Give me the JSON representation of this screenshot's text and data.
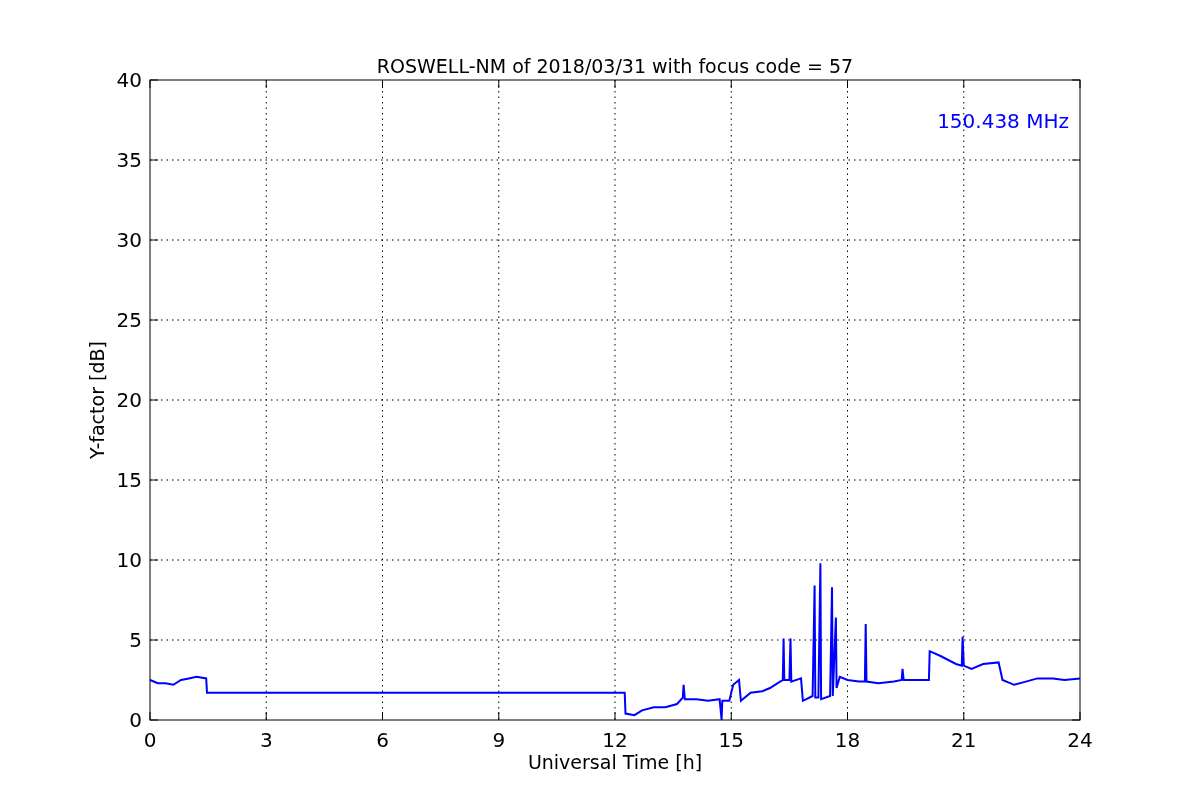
{
  "figure": {
    "chart_data": {
      "type": "line",
      "title": "ROSWELL-NM of 2018/03/31 with focus code = 57",
      "xlabel": "Universal Time [h]",
      "ylabel": "Y-factor [dB]",
      "xlim": [
        0,
        24
      ],
      "ylim": [
        0,
        40
      ],
      "xticks": [
        0,
        3,
        6,
        9,
        12,
        15,
        18,
        21,
        24
      ],
      "yticks": [
        0,
        5,
        10,
        15,
        20,
        25,
        30,
        35,
        40
      ],
      "x": [
        0,
        0.2,
        0.4,
        0.6,
        0.8,
        1.0,
        1.2,
        1.45,
        1.47,
        12.25,
        12.27,
        12.5,
        12.7,
        13.0,
        13.3,
        13.6,
        13.75,
        13.77,
        13.8,
        14.1,
        14.4,
        14.7,
        14.75,
        14.77,
        14.95,
        15.05,
        15.2,
        15.25,
        15.5,
        15.8,
        16.0,
        16.2,
        16.33,
        16.35,
        16.37,
        16.5,
        16.53,
        16.55,
        16.8,
        16.85,
        17.1,
        17.15,
        17.17,
        17.25,
        17.3,
        17.32,
        17.55,
        17.6,
        17.62,
        17.7,
        17.72,
        17.8,
        18.0,
        18.3,
        18.45,
        18.47,
        18.49,
        18.8,
        19.2,
        19.4,
        19.42,
        19.45,
        19.8,
        20.1,
        20.12,
        20.4,
        20.8,
        20.95,
        20.97,
        21.0,
        21.2,
        21.5,
        21.9,
        22.0,
        22.3,
        22.6,
        22.9,
        23.3,
        23.6,
        24
      ],
      "series": [
        {
          "name": "150.438 MHz",
          "color": "#0000ff",
          "values": [
            2.5,
            2.3,
            2.3,
            2.2,
            2.5,
            2.6,
            2.7,
            2.6,
            1.7,
            1.7,
            0.4,
            0.3,
            0.6,
            0.8,
            0.8,
            1.0,
            1.4,
            2.2,
            1.3,
            1.3,
            1.2,
            1.3,
            0,
            1.2,
            1.2,
            2.2,
            2.5,
            1.2,
            1.7,
            1.8,
            2.0,
            2.3,
            2.5,
            5.1,
            2.5,
            2.5,
            5.1,
            2.4,
            2.6,
            1.2,
            1.5,
            8.4,
            1.4,
            1.4,
            9.8,
            1.3,
            1.5,
            8.3,
            1.5,
            6.4,
            2.0,
            2.7,
            2.5,
            2.4,
            2.4,
            6.0,
            2.4,
            2.3,
            2.4,
            2.5,
            3.2,
            2.5,
            2.5,
            2.5,
            4.3,
            4.0,
            3.5,
            3.4,
            5.2,
            3.4,
            3.2,
            3.5,
            3.6,
            2.5,
            2.2,
            2.4,
            2.6,
            2.6,
            2.5,
            2.6
          ]
        }
      ],
      "grid": true
    }
  }
}
